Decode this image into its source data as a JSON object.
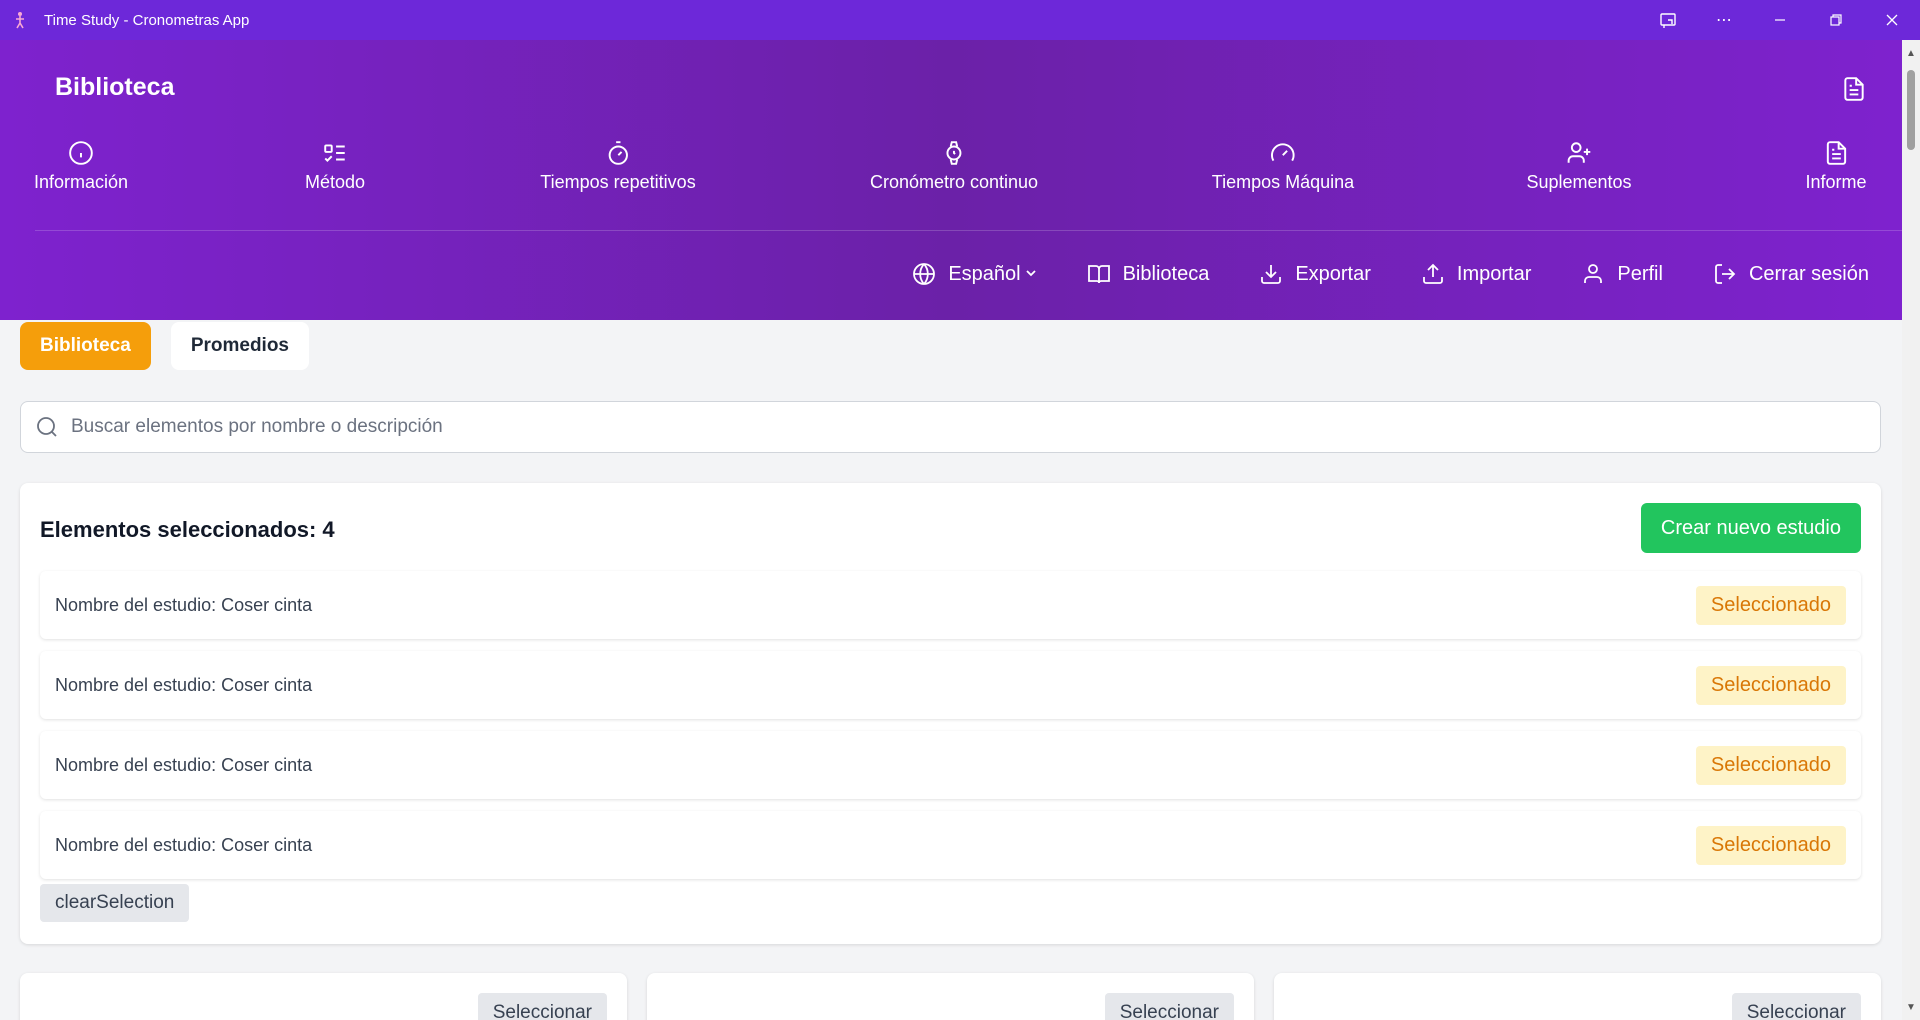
{
  "window": {
    "title": "Time Study - Cronometras App",
    "controls": [
      "cast-icon",
      "more-icon",
      "minimize-icon",
      "restore-icon",
      "close-icon"
    ]
  },
  "header": {
    "title": "Biblioteca",
    "nav": [
      {
        "label": "Información",
        "icon": "info-icon"
      },
      {
        "label": "Método",
        "icon": "list-check-icon"
      },
      {
        "label": "Tiempos repetitivos",
        "icon": "timer-icon"
      },
      {
        "label": "Cronómetro continuo",
        "icon": "watch-icon"
      },
      {
        "label": "Tiempos Máquina",
        "icon": "gauge-icon"
      },
      {
        "label": "Suplementos",
        "icon": "user-plus-icon"
      },
      {
        "label": "Informe",
        "icon": "document-icon"
      }
    ],
    "actions": {
      "language": "Español",
      "library": "Biblioteca",
      "export": "Exportar",
      "import": "Importar",
      "profile": "Perfil",
      "logout": "Cerrar sesión"
    }
  },
  "tabs": [
    {
      "label": "Biblioteca",
      "active": true
    },
    {
      "label": "Promedios",
      "active": false
    }
  ],
  "search": {
    "placeholder": "Buscar elementos por nombre o descripción",
    "value": ""
  },
  "selected_panel": {
    "title": "Elementos seleccionados: 4",
    "create_label": "Crear nuevo estudio",
    "items": [
      {
        "name": "Nombre del estudio: Coser cinta",
        "status": "Seleccionado"
      },
      {
        "name": "Nombre del estudio: Coser cinta",
        "status": "Seleccionado"
      },
      {
        "name": "Nombre del estudio: Coser cinta",
        "status": "Seleccionado"
      },
      {
        "name": "Nombre del estudio: Coser cinta",
        "status": "Seleccionado"
      }
    ],
    "clear_label": "clearSelection"
  },
  "cards": [
    {
      "select_label": "Seleccionar"
    },
    {
      "select_label": "Seleccionar"
    },
    {
      "select_label": "Seleccionar"
    }
  ],
  "colors": {
    "header": "#7e22ce",
    "titlebar": "#6d28d9",
    "tab_active": "#f59e0b",
    "create_button": "#22c55e",
    "badge_bg": "#fef3c7",
    "badge_text": "#d97706"
  }
}
